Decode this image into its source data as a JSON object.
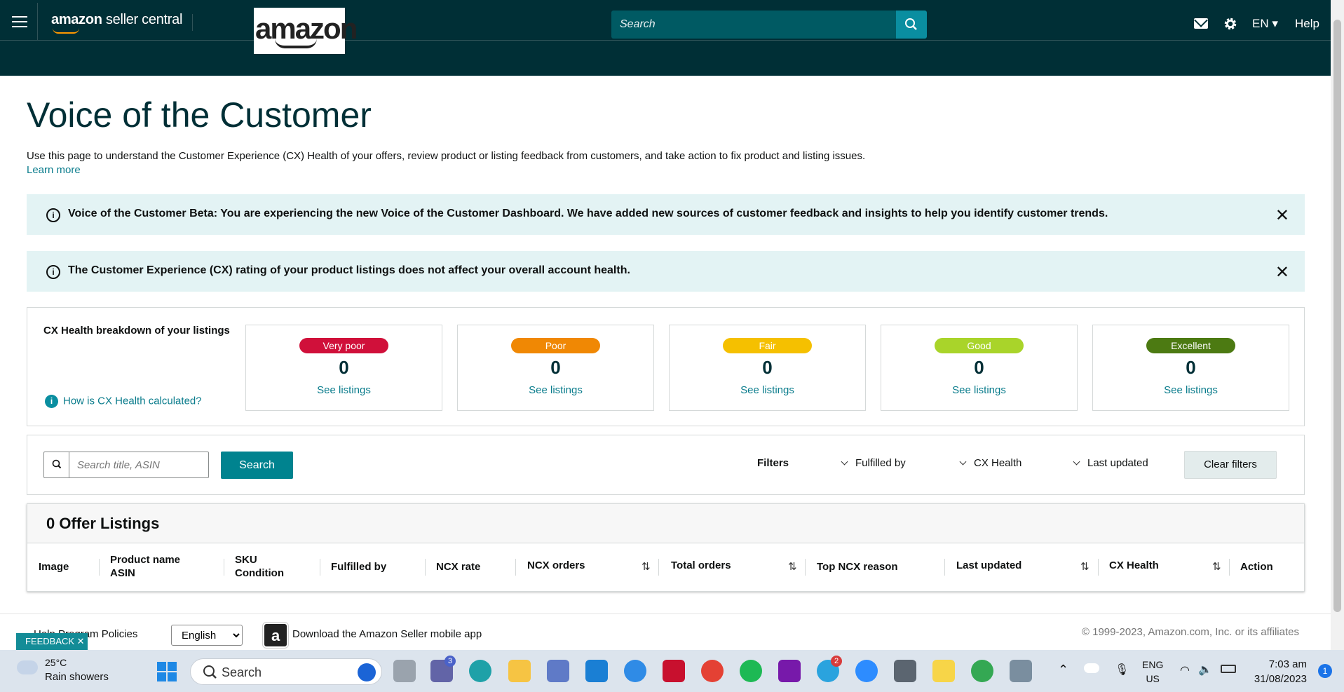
{
  "header": {
    "brand_bold": "amazon",
    "brand_light": " seller central",
    "logo_text": "amazon",
    "search_placeholder": "Search",
    "lang_label": "EN ▾",
    "help_label": "Help"
  },
  "page": {
    "title": "Voice of the Customer",
    "intro": "Use this page to understand the Customer Experience (CX) Health of your offers, review product or listing feedback from customers, and take action to fix product and listing issues.",
    "learn_more": "Learn more"
  },
  "alerts": [
    {
      "message": "Voice of the Customer Beta: You are experiencing the new Voice of the Customer Dashboard. We have added new sources of customer feedback and insights to help you identify customer trends."
    },
    {
      "message": "The Customer Experience (CX) rating of your product listings does not affect your overall account health."
    }
  ],
  "cx_health": {
    "heading": "CX Health breakdown of your listings",
    "how_link": "How is CX Health calculated?",
    "tiles": [
      {
        "label": "Very poor",
        "count": "0",
        "link": "See listings",
        "color": "#d0103a"
      },
      {
        "label": "Poor",
        "count": "0",
        "link": "See listings",
        "color": "#f08804"
      },
      {
        "label": "Fair",
        "count": "0",
        "link": "See listings",
        "color": "#f5c000"
      },
      {
        "label": "Good",
        "count": "0",
        "link": "See listings",
        "color": "#a9d42a"
      },
      {
        "label": "Excellent",
        "count": "0",
        "link": "See listings",
        "color": "#4c7a12"
      }
    ]
  },
  "filters": {
    "search_placeholder": "Search title, ASIN",
    "search_button": "Search",
    "filters_label": "Filters",
    "fulfilled_by": "Fulfilled by",
    "cx_health": "CX Health",
    "last_updated": "Last updated",
    "clear_button": "Clear filters"
  },
  "listings": {
    "title": "0 Offer Listings",
    "columns": [
      "Image",
      "Product name\nASIN",
      "SKU\nCondition",
      "Fulfilled by",
      "NCX rate",
      "NCX orders",
      "Total orders",
      "Top NCX reason",
      "Last updated",
      "CX Health",
      "Action"
    ]
  },
  "footer": {
    "links": "Help   Program Policies",
    "language": "English",
    "app_text": "Download the Amazon Seller mobile app",
    "copyright": "© 1999-2023, Amazon.com, Inc. or its affiliates",
    "feedback": "FEEDBACK ✕"
  },
  "taskbar": {
    "temp": "25°C",
    "condition": "Rain showers",
    "search": "Search",
    "lang_line1": "ENG",
    "lang_line2": "US",
    "time": "7:03 am",
    "date": "31/08/2023",
    "teams_badge": "3",
    "telegram_badge": "2",
    "notifications": "1"
  }
}
